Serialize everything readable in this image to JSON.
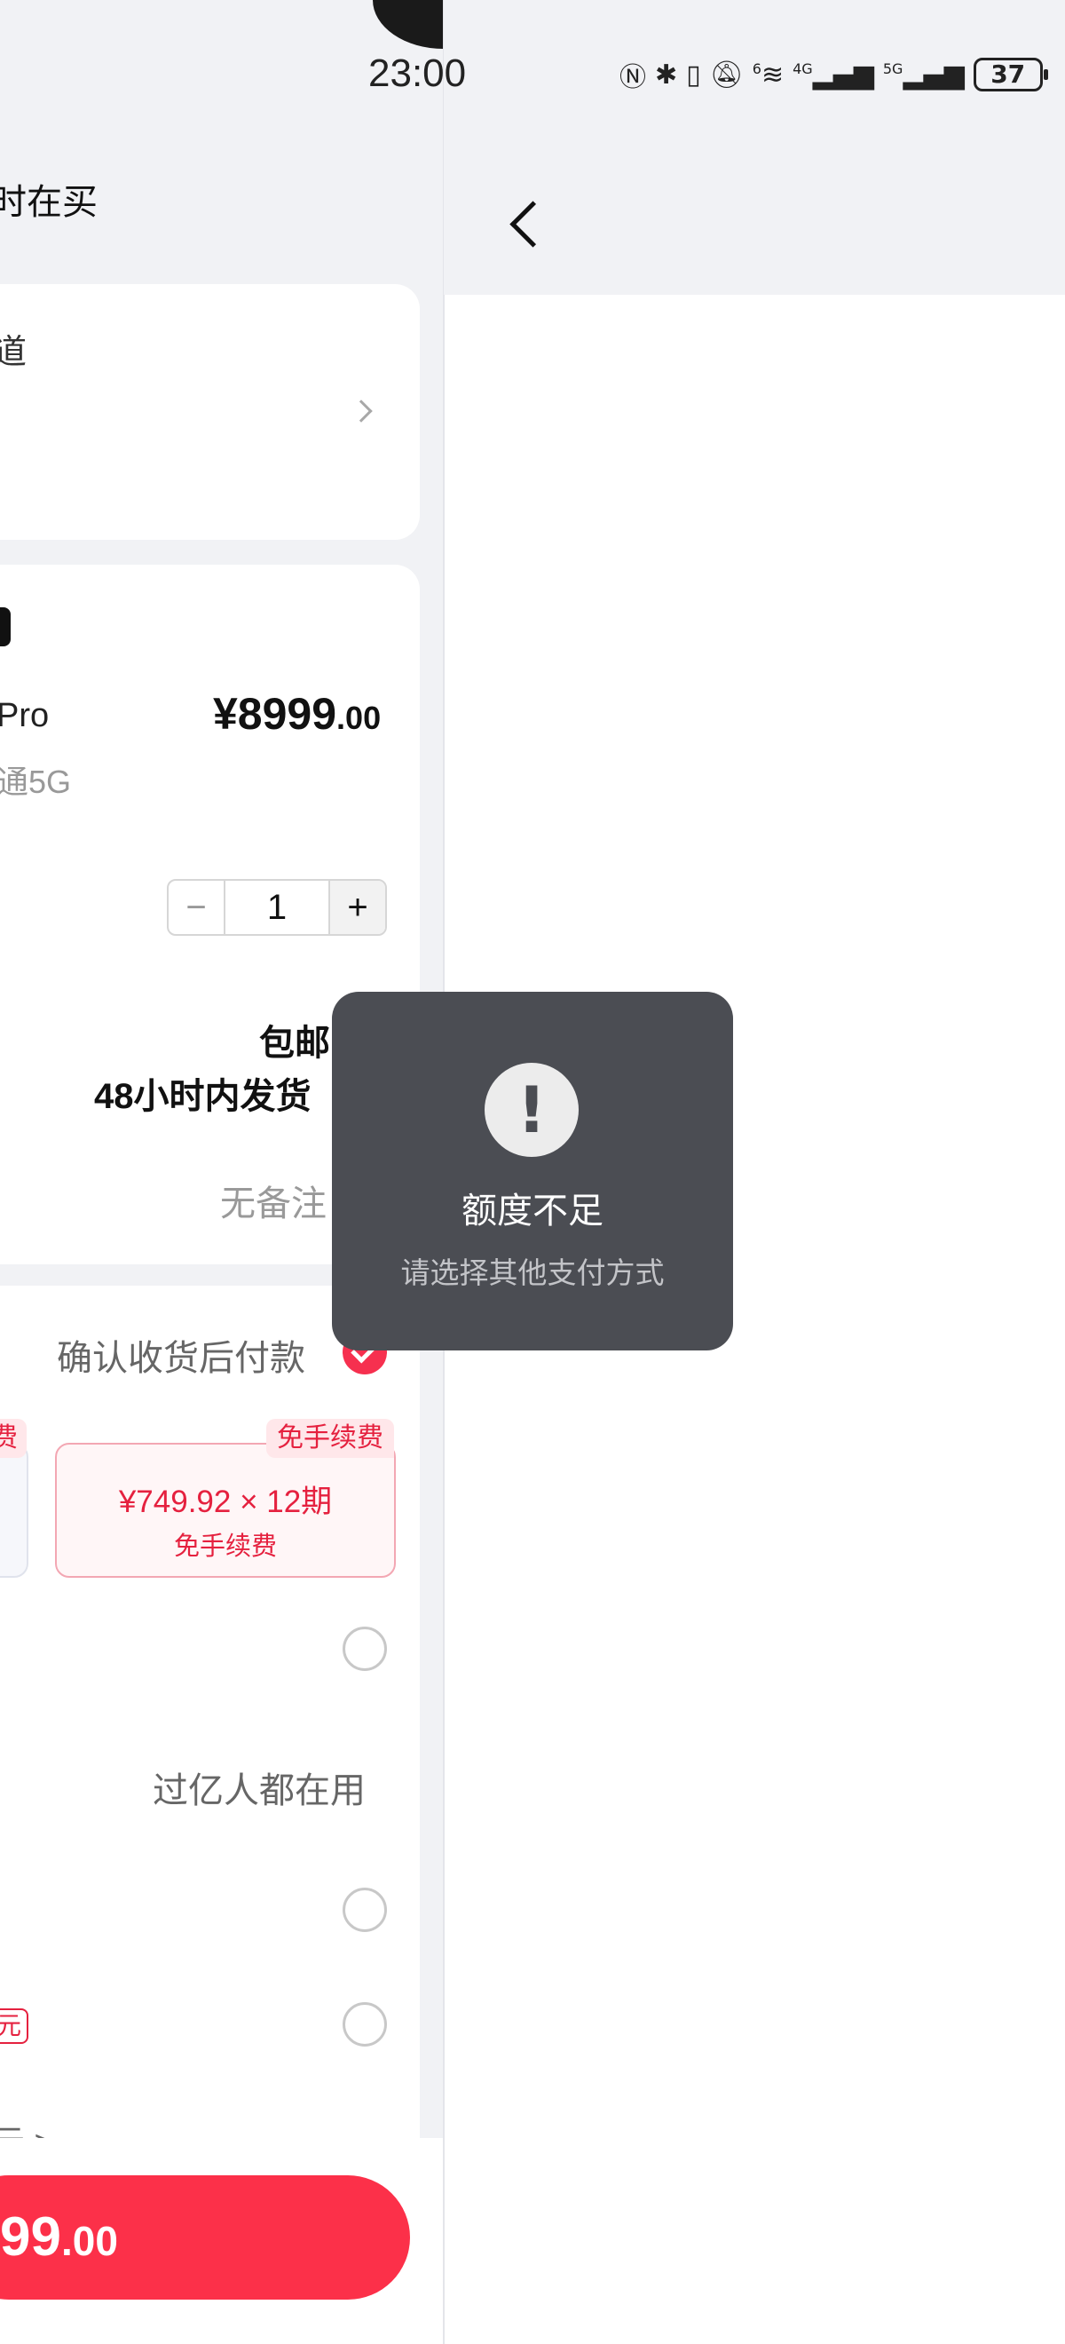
{
  "status_bar": {
    "time": "23:00",
    "icons": [
      "nfc-icon",
      "bluetooth-icon",
      "vibrate-icon",
      "mute-icon",
      "wifi-6-icon",
      "signal-4g-icon",
      "signal-5g-icon"
    ],
    "network_4g": "4G",
    "network_5g": "5G",
    "wifi_label": "6",
    "battery": "37"
  },
  "left_page": {
    "title_fragment": "时在买",
    "address_fragment": "道",
    "product": {
      "name_fragment": "Pro",
      "spec_fragment": "通5G",
      "price": "¥8999",
      "price_decimal": ".00",
      "quantity": "1",
      "minus": "−",
      "plus": "+"
    },
    "shipping": {
      "free_shipping": "包邮",
      "delivery": "48小时内发货",
      "note": "无备注"
    },
    "payment": {
      "pay_after_receipt": "确认收货后付款",
      "left_tag_fragment": "费",
      "tag": "免手续费",
      "plan_amount": "¥749.92 × 12期",
      "plan_fee": "免手续费",
      "popular_label": "过亿人都在用",
      "tag_fragment": "元",
      "more_fragment": "元 >"
    },
    "total_button": {
      "amount": "99",
      "decimal": ".00"
    }
  },
  "toast": {
    "icon": "!",
    "title": "额度不足",
    "subtitle": "请选择其他支付方式"
  },
  "colors": {
    "accent": "#fc3049",
    "toast_bg": "#4b4d53",
    "page_bg": "#f1f2f5"
  }
}
